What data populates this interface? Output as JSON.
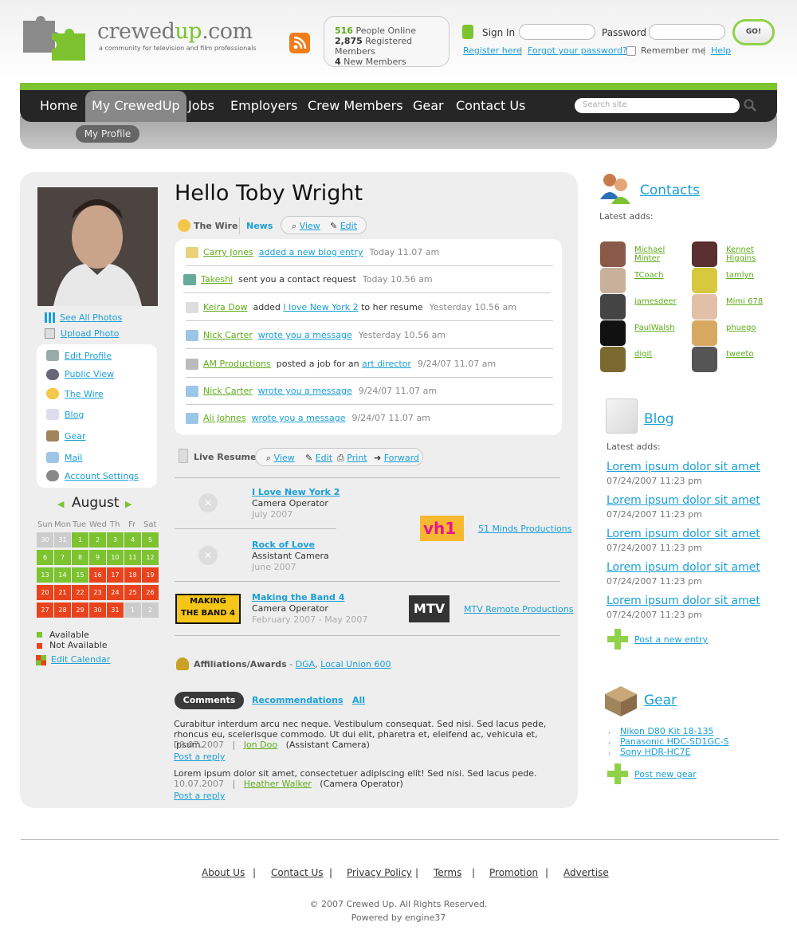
{
  "header": {
    "logo_main": "crewed",
    "logo_up": "up",
    "logo_tld": ".com",
    "logo_tagline": "a community for television and film professionals",
    "stats": [
      {
        "num": "516",
        "label": "People Online"
      },
      {
        "num": "2,875",
        "label": "Registered Members"
      },
      {
        "num": "4",
        "label": "New Members"
      }
    ],
    "signin_label": "Sign In",
    "password_label": "Password",
    "go_label": "GO!",
    "register": "Register here",
    "forgot": "Forgot your password?",
    "remember": "Remember me",
    "help": "Help"
  },
  "nav": {
    "items": [
      "Home",
      "My CrewedUp",
      "Jobs",
      "Employers",
      "Crew Members",
      "Gear",
      "Contact Us"
    ],
    "search_placeholder": "Search site",
    "sub_item": "My Profile"
  },
  "profile": {
    "greeting": "Hello Toby Wright",
    "see_all_photos": "See All Photos",
    "upload_photo": "Upload Photo",
    "menu": [
      "Edit Profile",
      "Public View",
      "The Wire",
      "Blog",
      "Gear",
      "Mail",
      "Account Settings"
    ]
  },
  "wire": {
    "tab_wire": "The Wire",
    "tab_news": "News",
    "view": "View",
    "edit": "Edit",
    "rows": [
      {
        "who": "Carry Jones",
        "action": "added a new blog entry",
        "time": "Today 11.07 am"
      },
      {
        "who": "Takeshi",
        "text": "sent you a contact request",
        "time": "Today 10.56 am"
      },
      {
        "who": "Keira Dow",
        "text": "added",
        "link": "I love New York 2",
        "text2": "to her resume",
        "time": "Yesterday 10.56 am"
      },
      {
        "who": "Nick Carter",
        "action": "wrote you a message",
        "time": "Yesterday 10.56 am"
      },
      {
        "who": "AM Productions",
        "text": "posted a job for an",
        "link": "art director",
        "time": "9/24/07 11.07 am"
      },
      {
        "who": "Nick Carter",
        "action": "wrote you a message",
        "time": "9/24/07 11.07 am"
      },
      {
        "who": "Ali Johnes",
        "action": "wrote you a message",
        "time": "9/24/07 11.07 am"
      }
    ]
  },
  "resume": {
    "title": "Live Resume",
    "actions": [
      "View",
      "Edit",
      "Print",
      "Forward"
    ],
    "entries": [
      {
        "title": "I Love New York 2",
        "role": "Camera Operator",
        "date": "July 2007"
      },
      {
        "title": "Rock of Love",
        "role": "Assistant Camera",
        "date": "June 2007"
      },
      {
        "title": "Making the Band 4",
        "role": "Camera Operator",
        "date": "February 2007 - May 2007"
      }
    ],
    "producers": [
      "51 Minds Productions",
      "MTV Remote Productions"
    ],
    "logo_vh1": "vh1",
    "logo_mtb_1": "MAKING",
    "logo_mtb_2": "THE BAND 4",
    "logo_mtv": "MTV"
  },
  "affiliations": {
    "label": "Affiliations/Awards",
    "dash": " - ",
    "items": [
      "DGA",
      "Local Union 600"
    ]
  },
  "comments": {
    "tabs": [
      "Comments",
      "Recommendations",
      "All"
    ],
    "items": [
      {
        "text": "Curabitur interdum arcu nec neque. Vestibulum consequat. Sed nisi. Sed lacus pede, rhoncus eu, scelerisque commodo. Ut dui elit, pharetra et, eleifend ac, vehicula et, ipsum.",
        "date": "09.07.2007",
        "author": "Jon Doo",
        "role": "(Assistant Camera)"
      },
      {
        "text": "Lorem ipsum dolor sit amet, consectetuer adipiscing elit! Sed nisi. Sed lacus pede.",
        "date": "10.07.2007",
        "author": "Heather Walker",
        "role": "(Camera Operator)"
      }
    ],
    "reply": "Post a reply",
    "sep": "|"
  },
  "calendar": {
    "month": "August",
    "days": [
      "Sun",
      "Mon",
      "Tue",
      "Wed",
      "Th",
      "Fr",
      "Sat"
    ],
    "cells": [
      [
        "30",
        "31",
        "1",
        "2",
        "3",
        "4",
        "5"
      ],
      [
        "6",
        "7",
        "8",
        "9",
        "10",
        "11",
        "12"
      ],
      [
        "13",
        "14",
        "15",
        "16",
        "17",
        "18",
        "19"
      ],
      [
        "20",
        "21",
        "22",
        "23",
        "24",
        "25",
        "26"
      ],
      [
        "27",
        "28",
        "29",
        "30",
        "31",
        "1",
        "2"
      ]
    ],
    "available": "Available",
    "not_available": "Not Available",
    "edit": "Edit Calendar",
    "colors": {
      "available": "#7cc32f",
      "not_available": "#e8431c",
      "other": "#cccccc"
    }
  },
  "contacts": {
    "title": "Contacts",
    "latest": "Latest adds:",
    "people": [
      "Michael Minter",
      "Kennet Higgins",
      "TCoach",
      "tamlyn",
      "jamesdeer",
      "Mimi 678",
      "PaulWalsh",
      "phuego",
      "digit",
      "tweeto"
    ]
  },
  "blog": {
    "title": "Blog",
    "latest": "Latest adds:",
    "entries": [
      {
        "title": "Lorem ipsum dolor sit amet",
        "date": "07/24/2007 11:23 pm"
      },
      {
        "title": "Lorem ipsum dolor sit amet",
        "date": "07/24/2007 11:23 pm"
      },
      {
        "title": "Lorem ipsum dolor sit amet",
        "date": "07/24/2007 11:23 pm"
      },
      {
        "title": "Lorem ipsum dolor sit amet",
        "date": "07/24/2007 11:23 pm"
      },
      {
        "title": "Lorem ipsum dolor sit amet",
        "date": "07/24/2007 11:23 pm"
      }
    ],
    "post": "Post a new entry"
  },
  "gear": {
    "title": "Gear",
    "items": [
      "Nikon D80 Kit 18-135",
      "Panasonic HDC-SD1GC-S",
      "Sony HDR-HC7E"
    ],
    "post": "Post new gear"
  },
  "footer": {
    "links": [
      "About Us",
      "Contact Us",
      "Privacy Policy",
      "Terms",
      "Promotion",
      "Advertise"
    ],
    "copyright": "© 2007 Crewed Up. All Rights Reserved.",
    "powered": "Powered by engine37"
  },
  "colors": {
    "accent_green": "#7cc32f",
    "link_blue": "#1a9fd6",
    "nav_dark": "#262626"
  }
}
